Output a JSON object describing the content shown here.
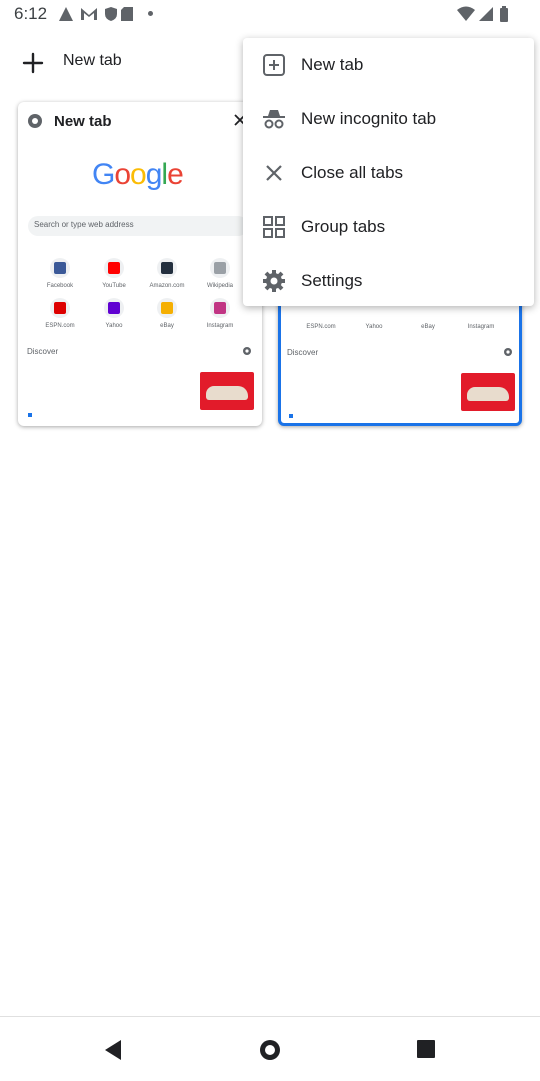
{
  "status_bar": {
    "time": "6:12"
  },
  "toolbar": {
    "new_tab_label": "New tab"
  },
  "tabs": [
    {
      "title": "New tab",
      "logo": "Google",
      "search_placeholder": "Search or type web address",
      "shortcuts": [
        "Facebook",
        "YouTube",
        "Amazon.com",
        "Wikipedia",
        "ESPN.com",
        "Yahoo",
        "eBay",
        "Instagram"
      ],
      "discover_label": "Discover"
    },
    {
      "shortcuts": [
        "ESPN.com",
        "Yahoo",
        "eBay",
        "Instagram"
      ],
      "discover_label": "Discover"
    }
  ],
  "menu": {
    "items": [
      {
        "label": "New tab",
        "icon": "add-box-icon"
      },
      {
        "label": "New incognito tab",
        "icon": "incognito-icon"
      },
      {
        "label": "Close all tabs",
        "icon": "close-icon"
      },
      {
        "label": "Group tabs",
        "icon": "group-tabs-icon"
      },
      {
        "label": "Settings",
        "icon": "gear-icon"
      }
    ]
  },
  "colors": {
    "accent": "#1a73e8",
    "icon": "#5f6368"
  }
}
